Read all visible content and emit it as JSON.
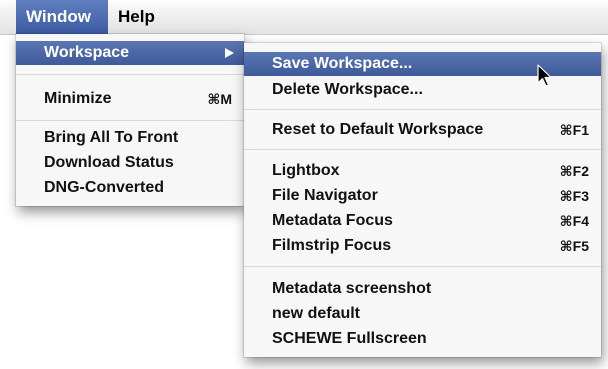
{
  "menubar": {
    "items": [
      {
        "label": "Window"
      },
      {
        "label": "Help"
      }
    ]
  },
  "window_menu": {
    "items": [
      {
        "label": "Workspace",
        "submenu_arrow": true
      },
      {
        "label": "Minimize",
        "shortcut": "⌘M"
      },
      {
        "label": "Bring All To Front"
      },
      {
        "label": "Download Status"
      },
      {
        "label": "DNG-Converted"
      }
    ]
  },
  "workspace_submenu": {
    "items": [
      {
        "label": "Save Workspace..."
      },
      {
        "label": "Delete Workspace..."
      },
      {
        "label": "Reset to Default Workspace",
        "shortcut": "⌘F1"
      },
      {
        "label": "Lightbox",
        "shortcut": "⌘F2"
      },
      {
        "label": "File Navigator",
        "shortcut": "⌘F3"
      },
      {
        "label": "Metadata Focus",
        "shortcut": "⌘F4"
      },
      {
        "label": "Filmstrip Focus",
        "shortcut": "⌘F5"
      },
      {
        "label": "Metadata screenshot"
      },
      {
        "label": "new default"
      },
      {
        "label": "SCHEWE Fullscreen"
      }
    ]
  },
  "colors": {
    "highlight": "#4a67a8",
    "menu_bg": "#f7f7f7"
  },
  "icons": {
    "submenu_arrow": "triangle-right-icon",
    "pointer": "mouse-pointer-icon"
  }
}
